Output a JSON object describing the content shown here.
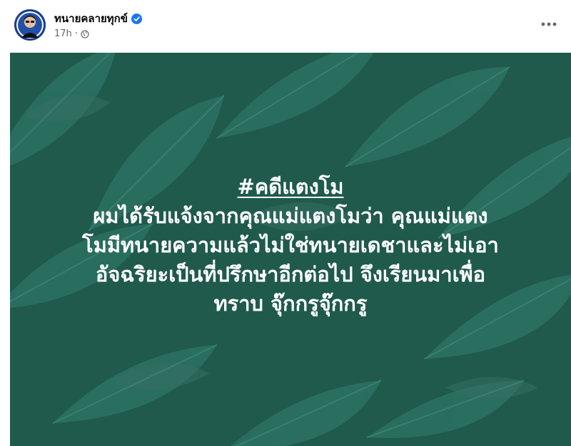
{
  "post": {
    "author": "ทนายคลายทุกข์",
    "time": "17h",
    "dot": "·",
    "verified_icon": "verified-badge-icon",
    "privacy_icon": "globe-icon",
    "more_icon": "more-horizontal-icon"
  },
  "image": {
    "hashtag": "#คดีแตงโม",
    "lines": [
      "ผมได้รับแจ้งจากคุณแม่แตงโมว่า คุณแม่แตง",
      "โมมีทนายความแล้วไม่ใช่ทนายเดชาและไม่เอา",
      "อัจฉริยะเป็นที่ปรึกษาอีกต่อไป จึงเรียนมาเพื่อ",
      "ทราบ จุ๊กกรูจุ๊กกรู"
    ],
    "colors": {
      "background": "#1f5a4d",
      "leaf_light": "#2a6e5d",
      "text": "#ffffff"
    }
  }
}
